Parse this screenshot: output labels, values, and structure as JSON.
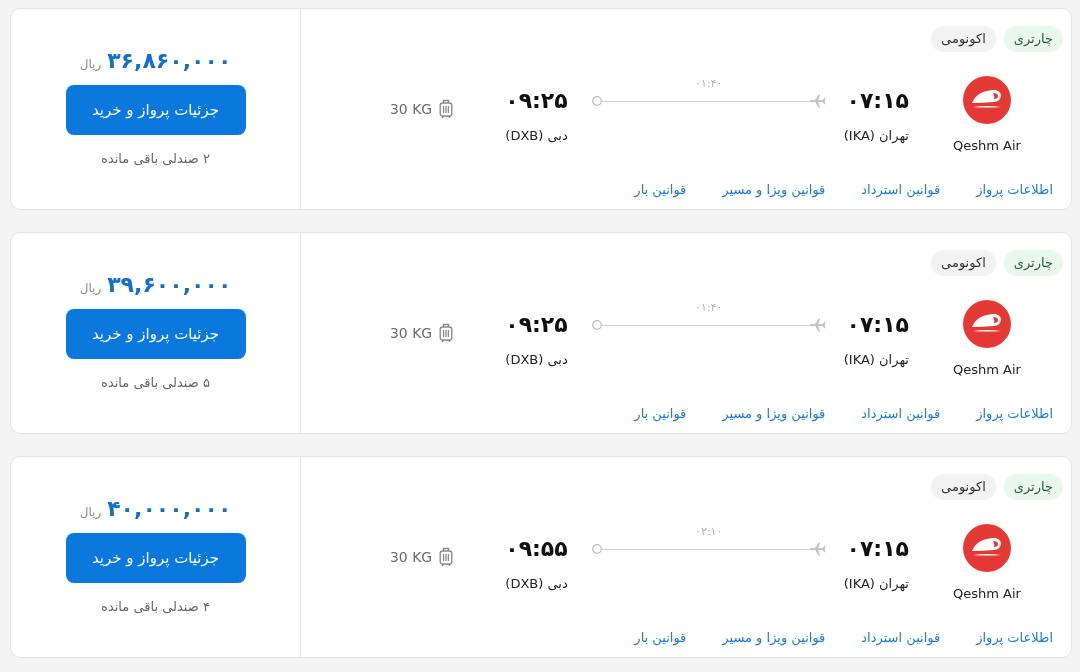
{
  "flights": [
    {
      "tags": [
        {
          "label": "چارتری",
          "kind": "charter"
        },
        {
          "label": "اکونومی",
          "kind": "cabin"
        }
      ],
      "airline": {
        "name": "Qeshm Air"
      },
      "departure": {
        "time": "۰۷:۱۵",
        "city": "تهران (IKA)"
      },
      "duration": "۰۱:۴۰",
      "arrival": {
        "time": "۰۹:۲۵",
        "city": "دبی (DXB)"
      },
      "baggage": "30 KG",
      "links": [
        "اطلاعات پرواز",
        "قوانین استرداد",
        "قوانین ویزا و مسیر",
        "قوانین بار"
      ],
      "price": "۳۶,۸۶۰,۰۰۰",
      "currency": "ریال",
      "button": "جزئیات پرواز و خرید",
      "seats": "۲ صندلی باقی مانده"
    },
    {
      "tags": [
        {
          "label": "چارتری",
          "kind": "charter"
        },
        {
          "label": "اکونومی",
          "kind": "cabin"
        }
      ],
      "airline": {
        "name": "Qeshm Air"
      },
      "departure": {
        "time": "۰۷:۱۵",
        "city": "تهران (IKA)"
      },
      "duration": "۰۱:۴۰",
      "arrival": {
        "time": "۰۹:۲۵",
        "city": "دبی (DXB)"
      },
      "baggage": "30 KG",
      "links": [
        "اطلاعات پرواز",
        "قوانین استرداد",
        "قوانین ویزا و مسیر",
        "قوانین بار"
      ],
      "price": "۳۹,۶۰۰,۰۰۰",
      "currency": "ریال",
      "button": "جزئیات پرواز و خرید",
      "seats": "۵ صندلی باقی مانده"
    },
    {
      "tags": [
        {
          "label": "چارتری",
          "kind": "charter"
        },
        {
          "label": "اکونومی",
          "kind": "cabin"
        }
      ],
      "airline": {
        "name": "Qeshm Air"
      },
      "departure": {
        "time": "۰۷:۱۵",
        "city": "تهران (IKA)"
      },
      "duration": "۰۲:۱۰",
      "arrival": {
        "time": "۰۹:۵۵",
        "city": "دبی (DXB)"
      },
      "baggage": "30 KG",
      "links": [
        "اطلاعات پرواز",
        "قوانین استرداد",
        "قوانین ویزا و مسیر",
        "قوانین بار"
      ],
      "price": "۴۰,۰۰۰,۰۰۰",
      "currency": "ریال",
      "button": "جزئیات پرواز و خرید",
      "seats": "۴ صندلی باقی مانده"
    }
  ]
}
